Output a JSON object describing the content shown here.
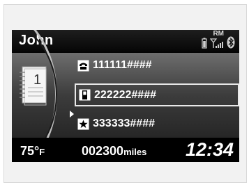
{
  "header": {
    "user_name": "John",
    "status": {
      "roaming_label": "RM",
      "icons": [
        "phone-battery-icon",
        "signal-strength-icon",
        "bluetooth-icon"
      ]
    }
  },
  "phonebook": {
    "icon": "phonebook-icon",
    "page_number": "1",
    "entries": [
      {
        "icon": "home-phone-icon",
        "number": "111111####",
        "selected": false
      },
      {
        "icon": "mobile-phone-icon",
        "number": "222222####",
        "selected": true
      },
      {
        "icon": "favorite-star-icon",
        "number": "333333####",
        "selected": false
      }
    ]
  },
  "footer": {
    "temperature_value": "75°",
    "temperature_unit": "F",
    "odometer_value": "002300",
    "odometer_unit": "miles",
    "clock": "12:34"
  }
}
